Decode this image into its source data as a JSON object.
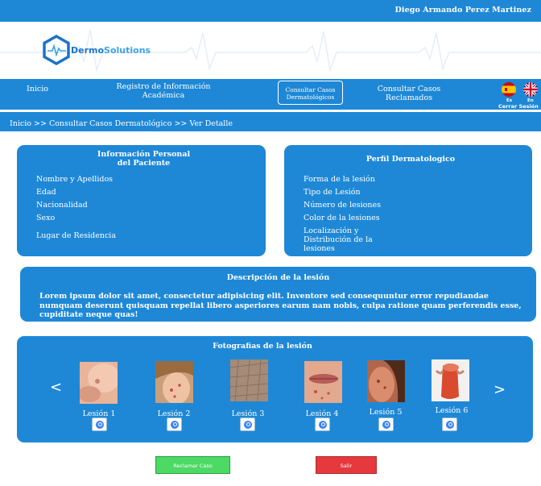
{
  "header": {
    "user_name": "Diego Armando Perez Martinez"
  },
  "brand": {
    "name_part1": "Dermo",
    "name_part2": "Solutions"
  },
  "nav": {
    "home": "Inicio",
    "register_line1": "Registro de Información",
    "register_line2": "Académica",
    "consult_line1": "Consultar Casos",
    "consult_line2": "Dermatológicos",
    "claimed_line1": "Consultar Casos",
    "claimed_line2": "Reclamados",
    "lang_es": "Es",
    "lang_en": "En",
    "logout": "Cerrar Sesión"
  },
  "breadcrumb": "Inicio  >> Consultar Casos Dermatológico >>  Ver Detalle",
  "personal": {
    "title_line1": "Información Personal",
    "title_line2": "del Paciente",
    "fields": [
      "Nombre y Apellidos",
      "Edad",
      "Nacionalidad",
      "Sexo",
      "Lugar de Residencia"
    ]
  },
  "profile": {
    "title": "Perfil Dermatologico",
    "fields": [
      "Forma de la lesión",
      "Tipo de Lesión",
      "Número de lesiones",
      "Color de la lesiones"
    ],
    "location_line1": "Localización y",
    "location_line2": "Distribución de la",
    "location_line3": "lesiones"
  },
  "description": {
    "title": "Descripción de la lesión",
    "text": "Lorem ipsum dolor sit amet, consectetur adipisicing elit. Inventore sed consequuntur error repudiandae numquam deserunt quisquam repellat libero asperiores earum nam nobis, culpa ratione quam perferendis esse, cupiditate neque quas!"
  },
  "photos": {
    "title": "Fotografias de la lesión",
    "prev": "<",
    "next": ">",
    "items": [
      {
        "label": "Lesión 1"
      },
      {
        "label": "Lesión 2"
      },
      {
        "label": "Lesión 3"
      },
      {
        "label": "Lesión 4"
      },
      {
        "label": "Lesión 5"
      },
      {
        "label": "Lesión 6"
      }
    ]
  },
  "actions": {
    "claim": "Reclamar Caso",
    "exit": "Salir"
  },
  "colors": {
    "primary": "#1e88d6",
    "claim_button": "#4cd964",
    "exit_button": "#e5393d"
  }
}
